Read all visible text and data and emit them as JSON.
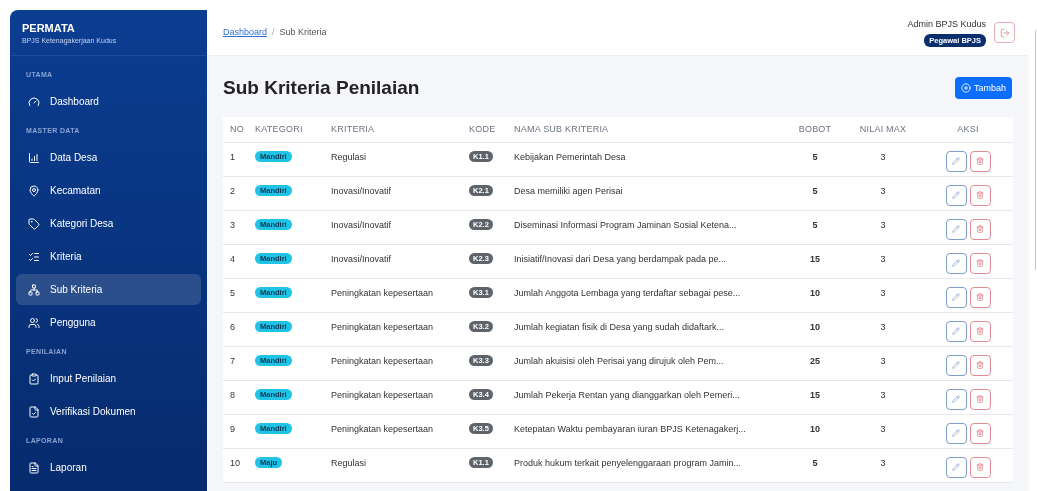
{
  "sidebar": {
    "brand": {
      "title": "PERMATA",
      "subtitle": "BPJS Ketenagakerjaan Kudus"
    },
    "sections": [
      {
        "title": "UTAMA",
        "items": [
          {
            "label": "Dashboard",
            "selected": false
          }
        ]
      },
      {
        "title": "MASTER DATA",
        "items": [
          {
            "label": "Data Desa",
            "selected": false
          },
          {
            "label": "Kecamatan",
            "selected": false
          },
          {
            "label": "Kategori Desa",
            "selected": false
          },
          {
            "label": "Kriteria",
            "selected": false
          },
          {
            "label": "Sub Kriteria",
            "selected": true
          },
          {
            "label": "Pengguna",
            "selected": false
          }
        ]
      },
      {
        "title": "PENILAIAN",
        "items": [
          {
            "label": "Input Penilaian",
            "selected": false
          },
          {
            "label": "Verifikasi Dokumen",
            "selected": false
          }
        ]
      },
      {
        "title": "LAPORAN",
        "items": [
          {
            "label": "Laporan",
            "selected": false
          }
        ]
      }
    ]
  },
  "breadcrumb": [
    {
      "label": "Dashboard",
      "kind": "link"
    },
    {
      "label": "/",
      "kind": "separator"
    },
    {
      "label": "Sub Kriteria",
      "kind": "current"
    }
  ],
  "user": {
    "name": "Admin BPJS Kudus",
    "role": "Pegawai BPJS"
  },
  "page_title": "Sub Kriteria Penilaian",
  "add_button": "Tambah",
  "table": {
    "columns": [
      "NO",
      "KATEGORI",
      "KRITERIA",
      "KODE",
      "NAMA SUB KRITERIA",
      "BOBOT",
      "NILAI MAX",
      "AKSI"
    ],
    "rows": [
      {
        "no": "1",
        "kategori": "Mandiri",
        "kriteria": "Regulasi",
        "kode": "K1.1",
        "nama": "Kebijakan Pemerintah Desa",
        "bobot": "5",
        "nilai_max": "3"
      },
      {
        "no": "2",
        "kategori": "Mandiri",
        "kriteria": "Inovasi/Inovatif",
        "kode": "K2.1",
        "nama": "Desa memiliki agen Perisai",
        "bobot": "5",
        "nilai_max": "3"
      },
      {
        "no": "3",
        "kategori": "Mandiri",
        "kriteria": "Inovasi/Inovatif",
        "kode": "K2.2",
        "nama": "Diseminasi Informasi Program Jaminan Sosial Ketena...",
        "bobot": "5",
        "nilai_max": "3"
      },
      {
        "no": "4",
        "kategori": "Mandiri",
        "kriteria": "Inovasi/Inovatif",
        "kode": "K2.3",
        "nama": "Inisiatif/Inovasi dari Desa yang berdampak pada pe...",
        "bobot": "15",
        "nilai_max": "3"
      },
      {
        "no": "5",
        "kategori": "Mandiri",
        "kriteria": "Peningkatan kepesertaan",
        "kode": "K3.1",
        "nama": "Jumlah Anggota Lembaga yang terdaftar sebagai pese...",
        "bobot": "10",
        "nilai_max": "3"
      },
      {
        "no": "6",
        "kategori": "Mandiri",
        "kriteria": "Peningkatan kepesertaan",
        "kode": "K3.2",
        "nama": "Jumlah kegiatan fisik di Desa yang sudah didaftark...",
        "bobot": "10",
        "nilai_max": "3"
      },
      {
        "no": "7",
        "kategori": "Mandiri",
        "kriteria": "Peningkatan kepesertaan",
        "kode": "K3.3",
        "nama": "Jumlah akuisisi oleh Perisai yang dirujuk oleh Pem...",
        "bobot": "25",
        "nilai_max": "3"
      },
      {
        "no": "8",
        "kategori": "Mandiri",
        "kriteria": "Peningkatan kepesertaan",
        "kode": "K3.4",
        "nama": "Jumlah Pekerja Rentan yang dianggarkan oleh Pemeri...",
        "bobot": "15",
        "nilai_max": "3"
      },
      {
        "no": "9",
        "kategori": "Mandiri",
        "kriteria": "Peningkatan kepesertaan",
        "kode": "K3.5",
        "nama": "Ketepatan Waktu pembayaran iuran BPJS Ketenagakerj...",
        "bobot": "10",
        "nilai_max": "3"
      },
      {
        "no": "10",
        "kategori": "Maju",
        "kriteria": "Regulasi",
        "kode": "K1.1",
        "nama": "Produk hukum terkait penyelenggaraan program Jamin...",
        "bobot": "5",
        "nilai_max": "3"
      }
    ]
  }
}
